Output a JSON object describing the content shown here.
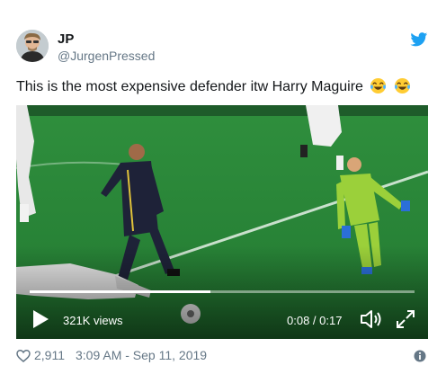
{
  "user": {
    "name": "JP",
    "handle": "@JurgenPressed"
  },
  "tweet": {
    "text": "This is the most expensive defender itw Harry Maguire",
    "emoji": [
      "face-with-tears-of-joy",
      "face-with-tears-of-joy"
    ]
  },
  "video": {
    "views": "321K views",
    "time": "0:08 / 0:17",
    "progress": 0.47
  },
  "footer": {
    "likes": "2,911",
    "timestamp": "3:09 AM - Sep 11, 2019"
  },
  "colors": {
    "twitter_blue": "#1da1f2",
    "secondary_text": "#657786",
    "pitch_green": "#2e8c3c"
  },
  "icons": [
    "twitter-bird-icon",
    "play-icon",
    "volume-icon",
    "fullscreen-icon",
    "heart-icon",
    "info-icon"
  ]
}
